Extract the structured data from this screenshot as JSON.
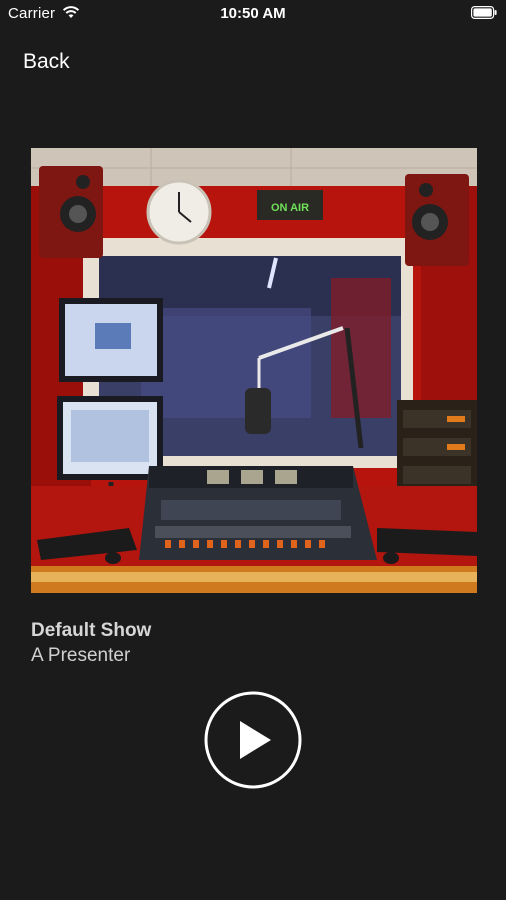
{
  "status_bar": {
    "carrier": "Carrier",
    "time": "10:50 AM",
    "wifi_icon": "wifi-icon",
    "battery_icon": "battery-icon"
  },
  "nav": {
    "back_label": "Back"
  },
  "artwork": {
    "on_air_label": "ON AIR",
    "description_icon": "radio-studio-photo"
  },
  "now_playing": {
    "show_title": "Default Show",
    "presenter": "A Presenter"
  },
  "controls": {
    "play_icon": "play-icon"
  },
  "colors": {
    "background": "#1b1b1b",
    "text_primary": "#ffffff",
    "text_secondary": "#d0d0d0"
  }
}
